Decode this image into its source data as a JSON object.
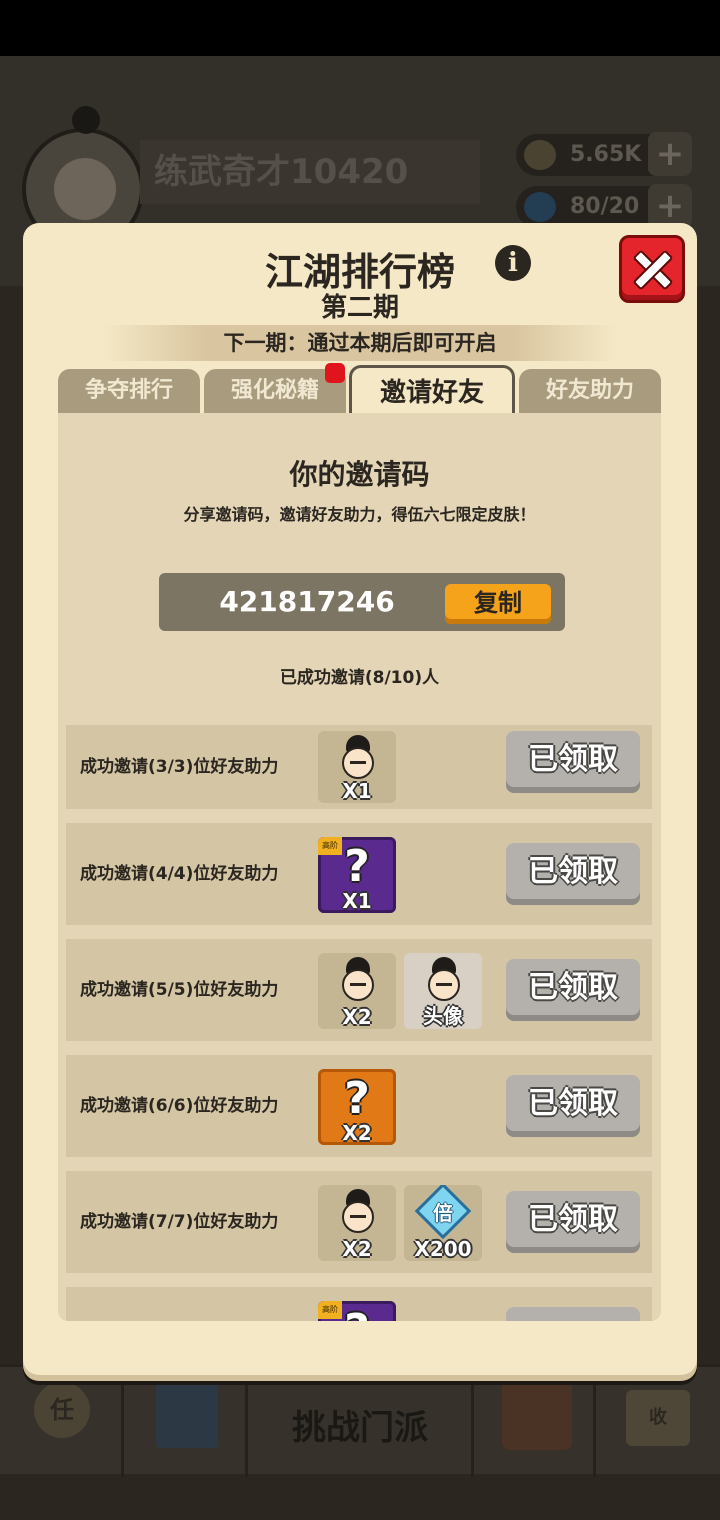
{
  "background": {
    "player_name": "练武奇才10420",
    "coins": "5.65K",
    "energy": "80/20",
    "challenge_label": "挑战门派",
    "task_icon_label": "任",
    "receive_icon_label": "收"
  },
  "panel": {
    "title": "江湖排行榜",
    "subtitle": "第二期",
    "next_period": "下一期：通过本期后即可开启",
    "tabs": [
      {
        "label": "争夺排行"
      },
      {
        "label": "强化秘籍"
      },
      {
        "label": "邀请好友"
      },
      {
        "label": "好友助力"
      }
    ],
    "invite": {
      "title": "你的邀请码",
      "description": "分享邀请码，邀请好友助力，得伍六七限定皮肤！",
      "code": "421817246",
      "copy_label": "复制",
      "progress": "已成功邀请(8/10)人"
    },
    "tasks": [
      {
        "label": "成功邀请(3/3)位好友助力",
        "rewards": [
          {
            "type": "fragment",
            "qty": "X1"
          }
        ],
        "button": "已领取"
      },
      {
        "label": "成功邀请(4/4)位好友助力",
        "rewards": [
          {
            "type": "mystery-purple",
            "qty": "X1",
            "tag": "高阶"
          }
        ],
        "button": "已领取"
      },
      {
        "label": "成功邀请(5/5)位好友助力",
        "rewards": [
          {
            "type": "fragment",
            "qty": "X2"
          },
          {
            "type": "portrait",
            "qty": "头像"
          }
        ],
        "button": "已领取"
      },
      {
        "label": "成功邀请(6/6)位好友助力",
        "rewards": [
          {
            "type": "mystery-orange",
            "qty": "X2"
          }
        ],
        "button": "已领取"
      },
      {
        "label": "成功邀请(7/7)位好友助力",
        "rewards": [
          {
            "type": "fragment",
            "qty": "X2"
          },
          {
            "type": "multiplier",
            "qty": "X200",
            "symbol": "倍"
          }
        ],
        "button": "已领取"
      },
      {
        "label": "",
        "rewards": [
          {
            "type": "mystery-purple",
            "qty": "",
            "tag": "高阶"
          }
        ],
        "button": ""
      }
    ]
  },
  "colors": {
    "panel_bg": "#f5e8c6",
    "content_bg": "#e3d5b6",
    "row_bg": "#d4c6a5",
    "copy_button": "#f4a31a",
    "close_button": "#e4262c",
    "claimed_button": "#b4b1ac"
  }
}
